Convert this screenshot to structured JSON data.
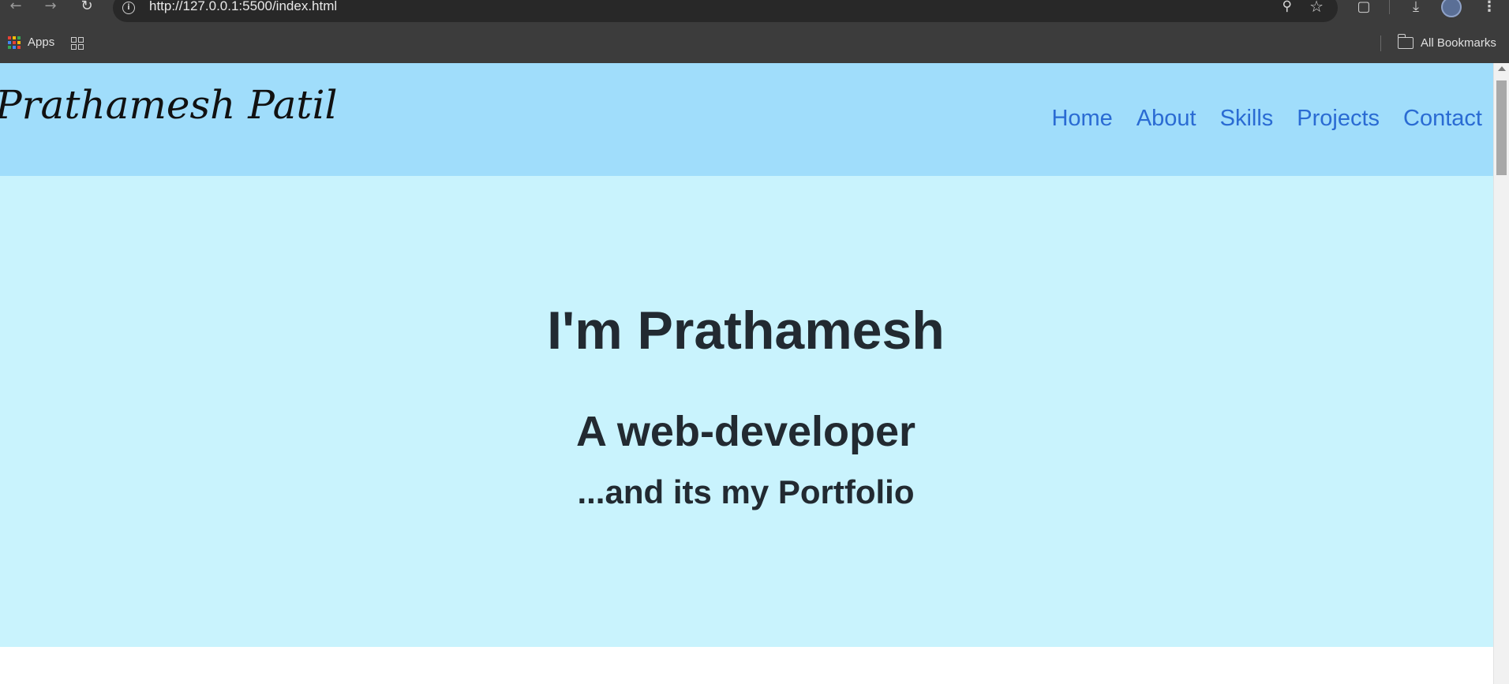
{
  "browser": {
    "url": "http://127.0.0.1:5500/index.html",
    "bookmarks_bar": {
      "apps_label": "Apps",
      "all_bookmarks_label": "All Bookmarks"
    },
    "icons": [
      "back-icon",
      "forward-icon",
      "reload-icon",
      "site-info-icon",
      "zoom-icon",
      "bookmark-star-icon",
      "extensions-icon",
      "download-icon",
      "profile-avatar",
      "menu-icon",
      "apps-grid-icon",
      "tab-groups-icon",
      "folder-icon"
    ]
  },
  "site": {
    "brand": "Prathamesh Patil",
    "nav": [
      {
        "label": "Home"
      },
      {
        "label": "About"
      },
      {
        "label": "Skills"
      },
      {
        "label": "Projects"
      },
      {
        "label": "Contact"
      }
    ],
    "hero": {
      "heading": "I'm Prathamesh",
      "subheading": "A web-developer",
      "tagline": "...and its my Portfolio"
    }
  },
  "colors": {
    "header_bg": "#a0ddfb",
    "hero_bg": "#c9f3fd",
    "nav_link": "#2a6bd3",
    "text_dark": "#222a31",
    "chrome_bg": "#3c3c3c"
  }
}
